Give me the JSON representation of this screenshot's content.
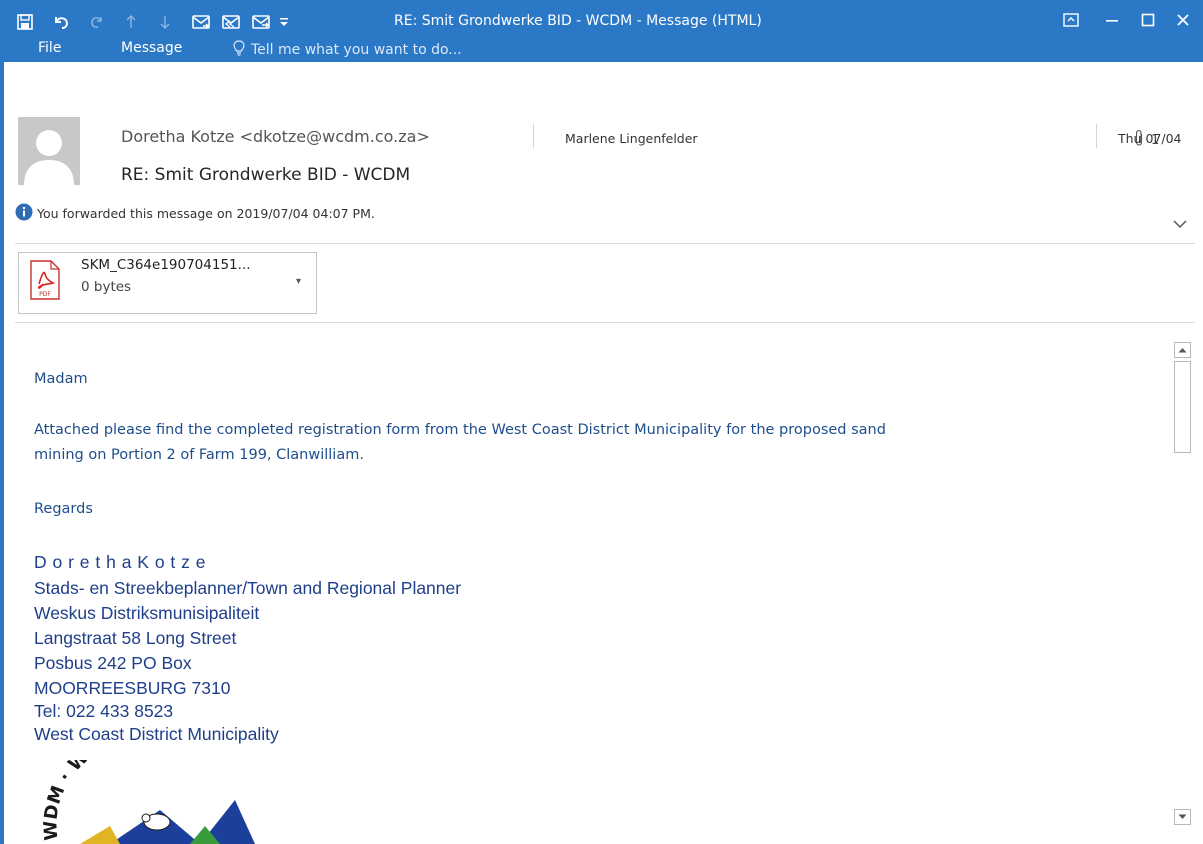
{
  "window": {
    "title": "RE: Smit Grondwerke BID - WCDM - Message (HTML)",
    "accent_color": "#2b78c6"
  },
  "quick_access": {
    "icons": [
      "save-icon",
      "undo-icon",
      "redo-icon",
      "up-icon",
      "down-icon",
      "reply-icon",
      "reply-all-icon",
      "forward-icon",
      "customize-icon"
    ]
  },
  "ribbon": {
    "tabs": [
      "File",
      "Message"
    ],
    "tell_me_placeholder": "Tell me what you want to do..."
  },
  "message": {
    "sender": "Doretha Kotze <dkotze@wcdm.co.za>",
    "to": "Marlene Lingenfelder",
    "attachment_count": "1",
    "date": "Thu 07/04",
    "subject": "RE: Smit Grondwerke BID - WCDM",
    "info": "You forwarded this message on 2019/07/04 04:07 PM."
  },
  "attachment": {
    "name": "SKM_C364e190704151...",
    "size": "0 bytes",
    "type_label": "PDF"
  },
  "body": {
    "greeting": "Madam",
    "paragraph_line1": "Attached please find the completed registration form from the West Coast District Municipality for the proposed sand",
    "paragraph_line2": "mining on Portion 2 of Farm 199, Clanwilliam.",
    "closing": "Regards"
  },
  "signature": {
    "name": "D o r e t h a  K o t z e",
    "title": "Stads- en Streekbeplanner/Town and Regional Planner",
    "org_af": "Weskus Distriksmunisipaliteit",
    "street": "Langstraat 58 Long Street",
    "pobox": "Posbus 242 PO Box",
    "town": "MOORREESBURG 7310",
    "tel": "Tel:  022 433 8523",
    "org_en": "West Coast District Municipality",
    "logo_text": "WDM · WEST COAST"
  }
}
